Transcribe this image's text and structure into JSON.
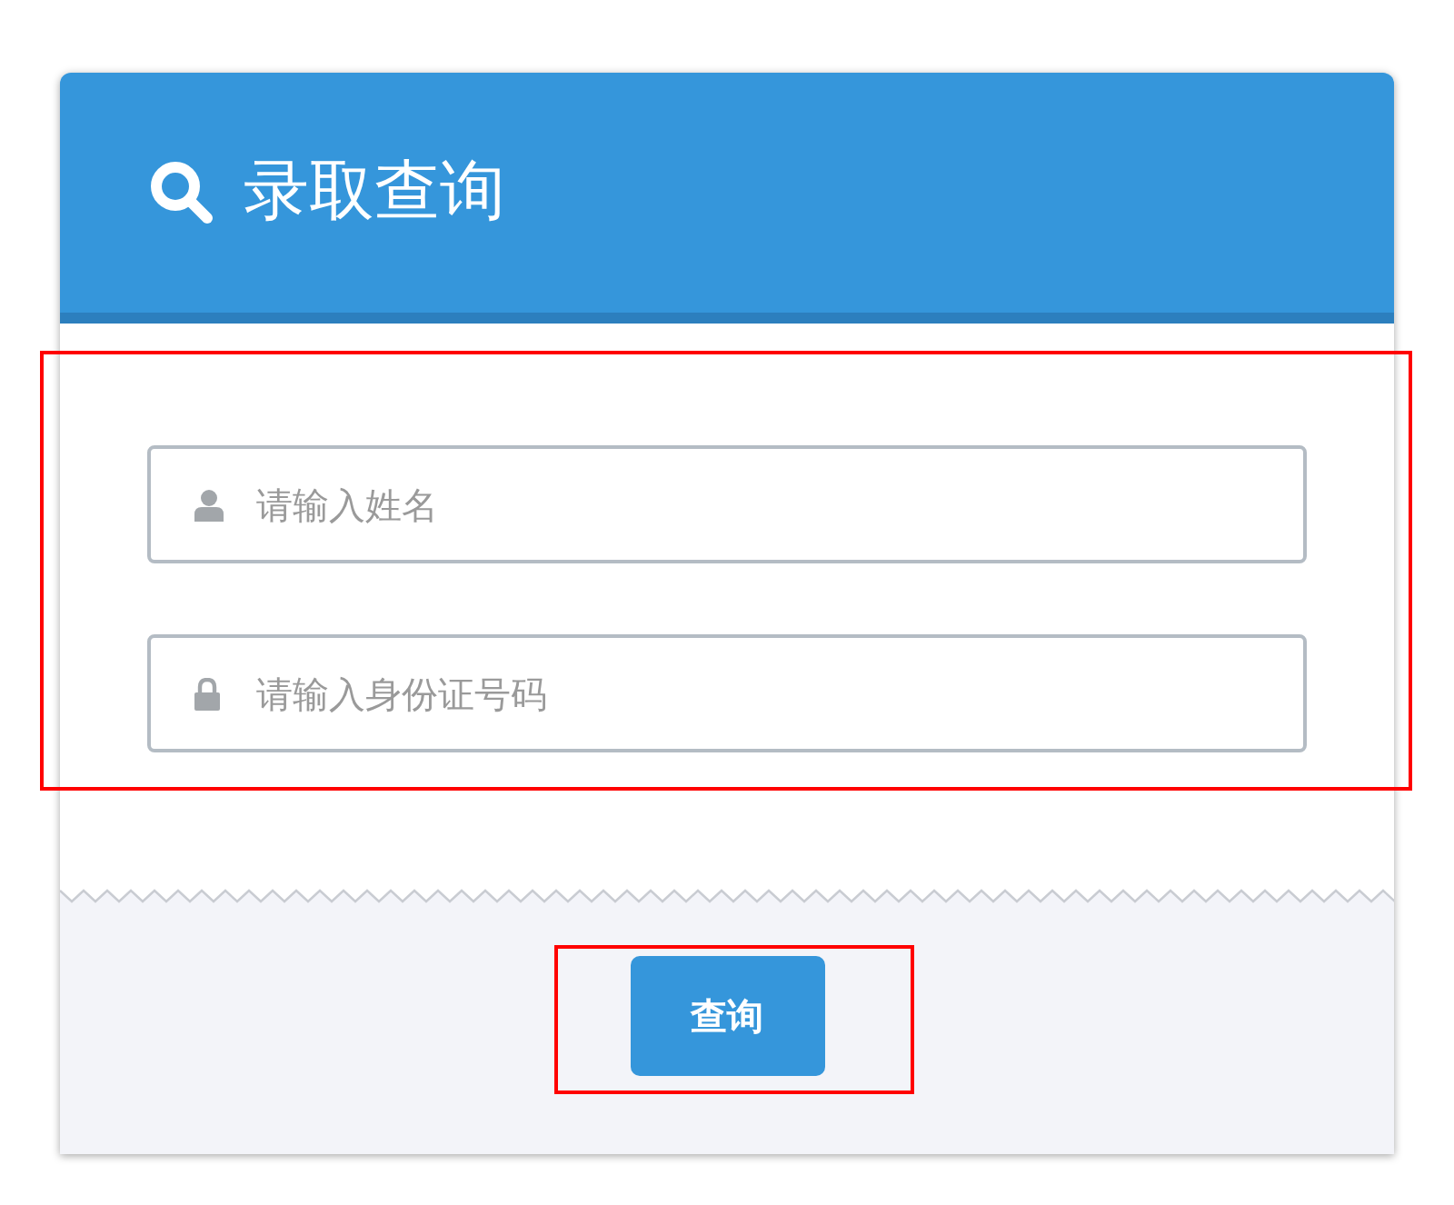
{
  "header": {
    "title": "录取查询"
  },
  "form": {
    "highlighted": true,
    "fields": [
      {
        "kind": "name",
        "placeholder": "请输入姓名"
      },
      {
        "kind": "id",
        "placeholder": "请输入身份证号码"
      }
    ]
  },
  "submit_button": {
    "label": "查询",
    "highlighted": true
  }
}
